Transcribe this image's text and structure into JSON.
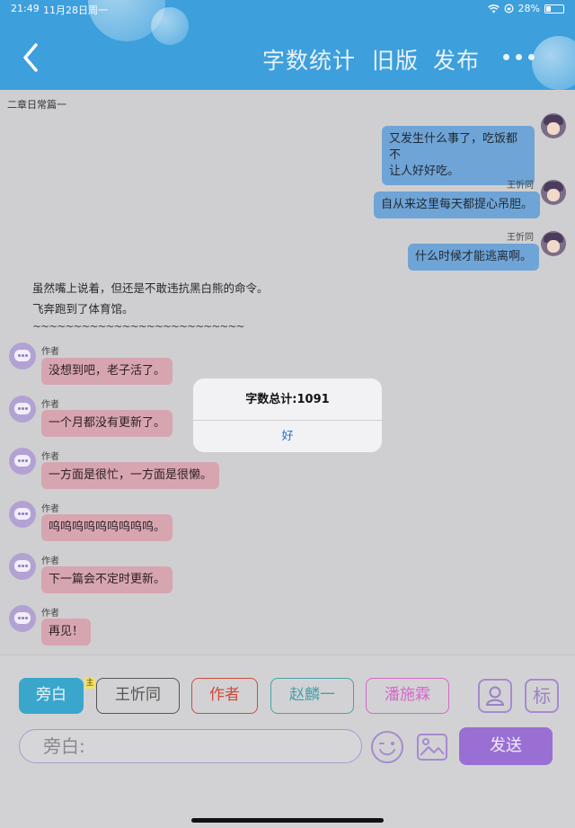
{
  "status_bar": {
    "time": "21:49",
    "date": "11月28日周一",
    "battery": "28%",
    "battery_level": 0.28,
    "icons": [
      "wifi-icon",
      "orientation-lock-icon",
      "battery-icon"
    ]
  },
  "header": {
    "back_icon": "chevron-left-icon",
    "word_count_label": "字数统计",
    "old_version_label": "旧版",
    "publish_label": "发布",
    "more_icon": "more-dots-icon",
    "bg_color": "#3d9fdc"
  },
  "chapter_title": "二章日常篇一",
  "chat": {
    "right_messages": [
      {
        "name": "王忻同",
        "lines": [
          "又发生什么事了，吃饭都不",
          "让人好好吃。"
        ]
      },
      {
        "name": "王忻同",
        "lines": [
          "自从来这里每天都提心吊胆。"
        ]
      },
      {
        "name": "王忻同",
        "lines": [
          "什么时候才能逃离啊。"
        ]
      }
    ],
    "narration": [
      "虽然嘴上说着，但还是不敢违抗黑白熊的命令。",
      "飞奔跑到了体育馆。",
      "~~~~~~~~~~~~~~~~~~~~~~~~~~"
    ],
    "left_messages": [
      {
        "name": "作者",
        "text": "没想到吧，老子活了。"
      },
      {
        "name": "作者",
        "text": "一个月都没有更新了。"
      },
      {
        "name": "作者",
        "text": "一方面是很忙，一方面是很懒。"
      },
      {
        "name": "作者",
        "text": "呜呜呜呜呜呜呜呜呜。"
      },
      {
        "name": "作者",
        "text": "下一篇会不定时更新。"
      },
      {
        "name": "作者",
        "text": "再见！"
      }
    ],
    "right_bubble_color": "#6fa4d6",
    "left_bubble_color": "#d7a5b0"
  },
  "dialog": {
    "title": "字数总计:1091",
    "ok_label": "好"
  },
  "bottom": {
    "roles": [
      {
        "label": "旁白",
        "color": "#3aa6cc",
        "selected": true
      },
      {
        "label": "王忻同",
        "color": "#555555",
        "selected": false
      },
      {
        "label": "作者",
        "color": "#d04a3c",
        "selected": false
      },
      {
        "label": "赵麟一",
        "color": "#4aa0a8",
        "selected": false
      },
      {
        "label": "潘施霖",
        "color": "#d467c9",
        "selected": false
      }
    ],
    "main_badge": "主",
    "tool_buttons": [
      {
        "icon": "person-card-icon",
        "label": ""
      },
      {
        "icon": "tag-icon",
        "label": "标"
      }
    ],
    "input_placeholder": "旁白:",
    "emoji_icon": "wink-emoji-icon",
    "image_icon": "image-icon",
    "send_label": "发送"
  }
}
